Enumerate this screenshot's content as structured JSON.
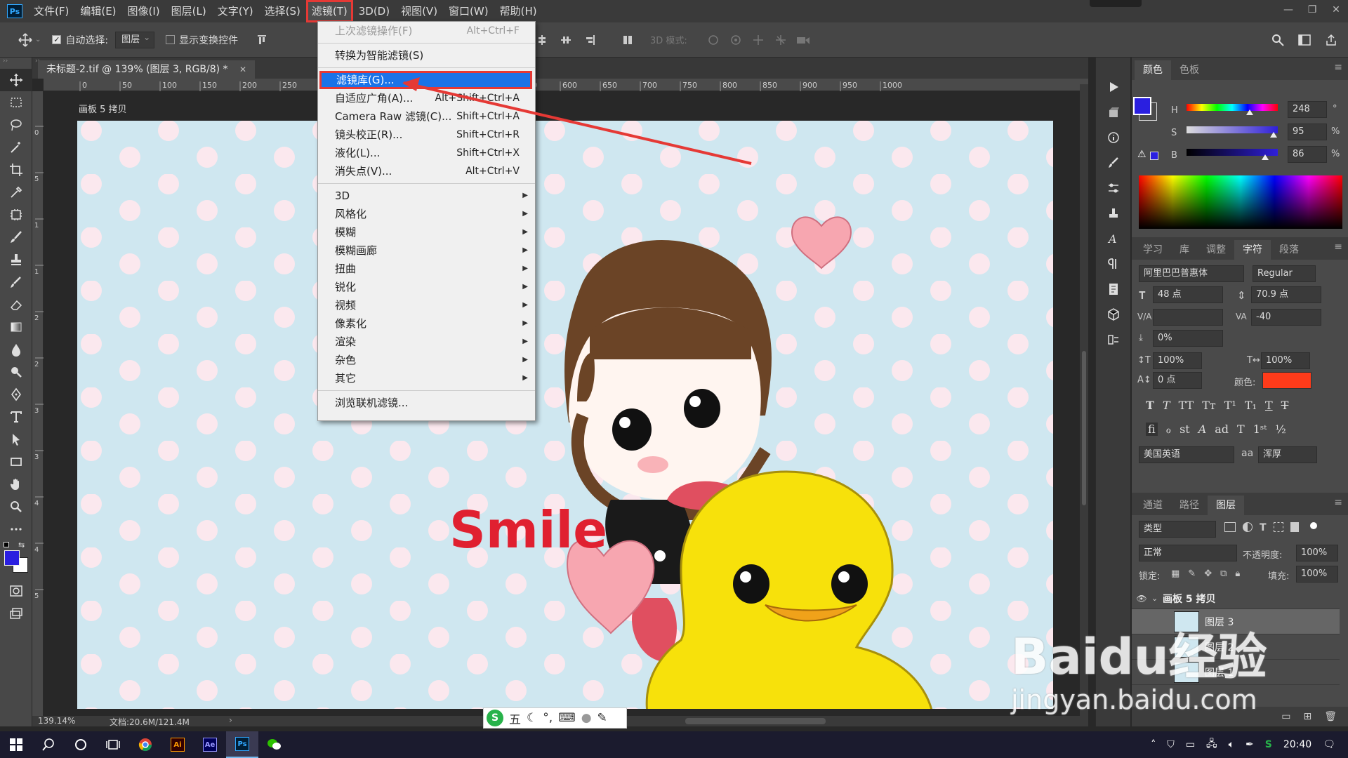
{
  "app": {
    "logo": "Ps",
    "colors": {
      "accent": "#1a73e8",
      "highlight_box": "#e53935",
      "fg_color": "#2a1fe0",
      "char_color": "#ff3b1a"
    }
  },
  "menubar": [
    "文件(F)",
    "编辑(E)",
    "图像(I)",
    "图层(L)",
    "文字(Y)",
    "选择(S)",
    "滤镜(T)",
    "3D(D)",
    "视图(V)",
    "窗口(W)",
    "帮助(H)"
  ],
  "options": {
    "auto_select_label": "自动选择:",
    "layer_select": "图层",
    "show_transform_label": "显示变换控件",
    "mode_3d_label": "3D 模式:"
  },
  "document": {
    "tab_title": "未标题-2.tif @ 139% (图层 3, RGB/8) *",
    "artboard_label": "画板 5 拷贝",
    "zoom": "139.14%",
    "doc_info": "文档:20.6M/121.4M",
    "canvas_text": "Smile"
  },
  "ruler": {
    "ticks": [
      "0",
      "50",
      "100",
      "150",
      "200",
      "250",
      "300",
      "350",
      "400",
      "450",
      "500",
      "550",
      "600",
      "650",
      "700",
      "750",
      "800",
      "850",
      "900",
      "950",
      "1000"
    ],
    "vticks": [
      "0",
      "5",
      "1",
      "1",
      "2",
      "2",
      "3",
      "3",
      "4",
      "4",
      "5"
    ]
  },
  "filter_menu": [
    {
      "label": "上次滤镜操作(F)",
      "shortcut": "Alt+Ctrl+F",
      "disabled": true
    },
    {
      "sep": true
    },
    {
      "label": "转换为智能滤镜(S)",
      "shortcut": ""
    },
    {
      "sep": true
    },
    {
      "label": "滤镜库(G)...",
      "shortcut": "",
      "highlight": true
    },
    {
      "label": "自适应广角(A)...",
      "shortcut": "Alt+Shift+Ctrl+A"
    },
    {
      "label": "Camera Raw 滤镜(C)...",
      "shortcut": "Shift+Ctrl+A"
    },
    {
      "label": "镜头校正(R)...",
      "shortcut": "Shift+Ctrl+R"
    },
    {
      "label": "液化(L)...",
      "shortcut": "Shift+Ctrl+X"
    },
    {
      "label": "消失点(V)...",
      "shortcut": "Alt+Ctrl+V"
    },
    {
      "sep": true
    },
    {
      "label": "3D",
      "sub": true
    },
    {
      "label": "风格化",
      "sub": true
    },
    {
      "label": "模糊",
      "sub": true
    },
    {
      "label": "模糊画廊",
      "sub": true
    },
    {
      "label": "扭曲",
      "sub": true
    },
    {
      "label": "锐化",
      "sub": true
    },
    {
      "label": "视频",
      "sub": true
    },
    {
      "label": "像素化",
      "sub": true
    },
    {
      "label": "渲染",
      "sub": true
    },
    {
      "label": "杂色",
      "sub": true
    },
    {
      "label": "其它",
      "sub": true
    },
    {
      "sep": true
    },
    {
      "label": "浏览联机滤镜...",
      "shortcut": ""
    }
  ],
  "color_panel": {
    "tabs": [
      "颜色",
      "色板"
    ],
    "h_label": "H",
    "s_label": "S",
    "b_label": "B",
    "h": "248",
    "s": "95",
    "b": "86",
    "deg": "°",
    "pct": "%",
    "h_level": 0.69,
    "s_level": 0.95,
    "b_level": 0.86
  },
  "char_panel": {
    "tabs": [
      "学习",
      "库",
      "调整",
      "字符",
      "段落"
    ],
    "font": "阿里巴巴普惠体",
    "style": "Regular",
    "size": "48 点",
    "leading": "70.9 点",
    "tracking": "-40",
    "tsume": "0%",
    "vscale": "100%",
    "hscale": "100%",
    "baseline": "0 点",
    "color_label": "颜色:",
    "lang": "美国英语",
    "aa": "浑厚",
    "aa_icon": "aa"
  },
  "layers_panel": {
    "tabs": [
      "通道",
      "路径",
      "图层"
    ],
    "filter": "类型",
    "blend": "正常",
    "opacity_label": "不透明度:",
    "opacity": "100%",
    "lock_label": "锁定:",
    "fill_label": "填充:",
    "fill": "100%",
    "layers": [
      {
        "name": "画板 5 拷贝",
        "group": true
      },
      {
        "name": "图层 3",
        "selected": true
      },
      {
        "name": "图层 2"
      },
      {
        "name": "图层 1"
      }
    ]
  },
  "taskbar": {
    "time": "20:40"
  },
  "watermark": {
    "line1": "Baidu经验",
    "line2": "jingyan.baidu.com"
  },
  "ime": {
    "text": "五"
  }
}
